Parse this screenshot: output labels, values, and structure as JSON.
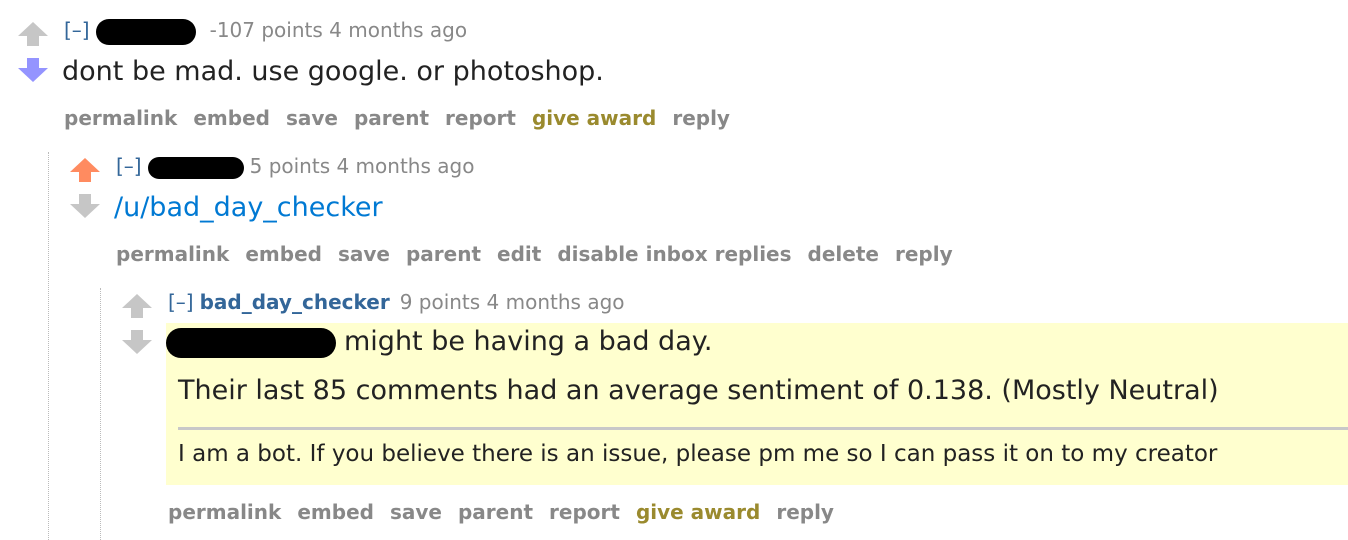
{
  "comments": [
    {
      "toggle": "[–]",
      "meta": "-107 points 4 months ago",
      "body": "dont be mad. use google. or photoshop.",
      "upvote_color": "#c6c6c6",
      "downvote_color": "#9494ff",
      "buttons": [
        "permalink",
        "embed",
        "save",
        "parent",
        "report",
        "give award",
        "reply"
      ]
    },
    {
      "toggle": "[–]",
      "meta": "5 points 4 months ago",
      "body": "/u/bad_day_checker",
      "upvote_color": "#ff8b60",
      "downvote_color": "#c6c6c6",
      "buttons": [
        "permalink",
        "embed",
        "save",
        "parent",
        "edit",
        "disable inbox replies",
        "delete",
        "reply"
      ]
    },
    {
      "toggle": "[–]",
      "author": "bad_day_checker",
      "meta": "9 points 4 months ago",
      "body_line1": "might be having a bad day.",
      "body_line2": "Their last 85 comments had an average sentiment of 0.138. (Mostly Neutral)",
      "body_line3": "I am a bot. If you believe there is an issue, please pm me so I can pass it on to my creator",
      "upvote_color": "#c6c6c6",
      "downvote_color": "#c6c6c6",
      "buttons": [
        "permalink",
        "embed",
        "save",
        "parent",
        "report",
        "give award",
        "reply"
      ]
    }
  ]
}
